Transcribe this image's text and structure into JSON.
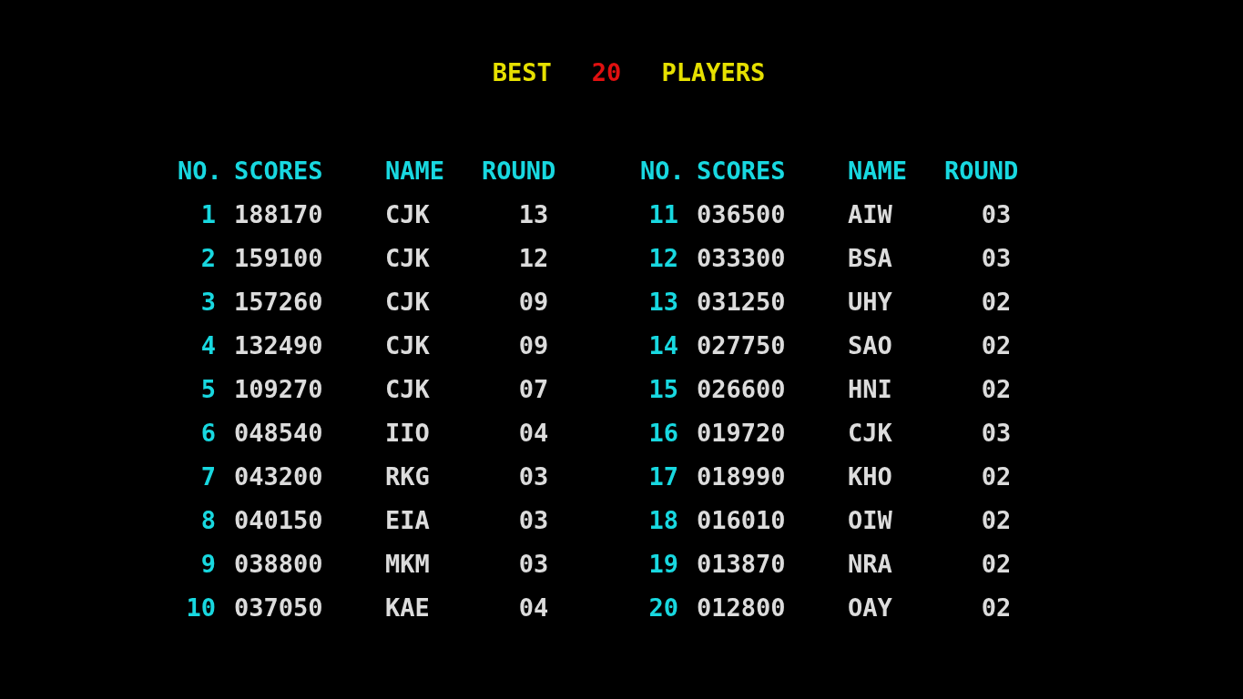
{
  "title": [
    {
      "text": "BEST",
      "color": "#e6e000"
    },
    {
      "text": "20",
      "color": "#e01010"
    },
    {
      "text": "PLAYERS",
      "color": "#e6e000"
    }
  ],
  "tables": [
    {
      "columns": [
        "NO.",
        "SCORES",
        "NAME",
        "ROUND"
      ],
      "rows": [
        [
          "1",
          "188170",
          "CJK",
          "13"
        ],
        [
          "2",
          "159100",
          "CJK",
          "12"
        ],
        [
          "3",
          "157260",
          "CJK",
          "09"
        ],
        [
          "4",
          "132490",
          "CJK",
          "09"
        ],
        [
          "5",
          "109270",
          "CJK",
          "07"
        ],
        [
          "6",
          "048540",
          "IIO",
          "04"
        ],
        [
          "7",
          "043200",
          "RKG",
          "03"
        ],
        [
          "8",
          "040150",
          "EIA",
          "03"
        ],
        [
          "9",
          "038800",
          "MKM",
          "03"
        ],
        [
          "10",
          "037050",
          "KAE",
          "04"
        ]
      ]
    },
    {
      "columns": [
        "NO.",
        "SCORES",
        "NAME",
        "ROUND"
      ],
      "rows": [
        [
          "11",
          "036500",
          "AIW",
          "03"
        ],
        [
          "12",
          "033300",
          "BSA",
          "03"
        ],
        [
          "13",
          "031250",
          "UHY",
          "02"
        ],
        [
          "14",
          "027750",
          "SAO",
          "02"
        ],
        [
          "15",
          "026600",
          "HNI",
          "02"
        ],
        [
          "16",
          "019720",
          "CJK",
          "03"
        ],
        [
          "17",
          "018990",
          "KHO",
          "02"
        ],
        [
          "18",
          "016010",
          "OIW",
          "02"
        ],
        [
          "19",
          "013870",
          "NRA",
          "02"
        ],
        [
          "20",
          "012800",
          "OAY",
          "02"
        ]
      ]
    }
  ]
}
